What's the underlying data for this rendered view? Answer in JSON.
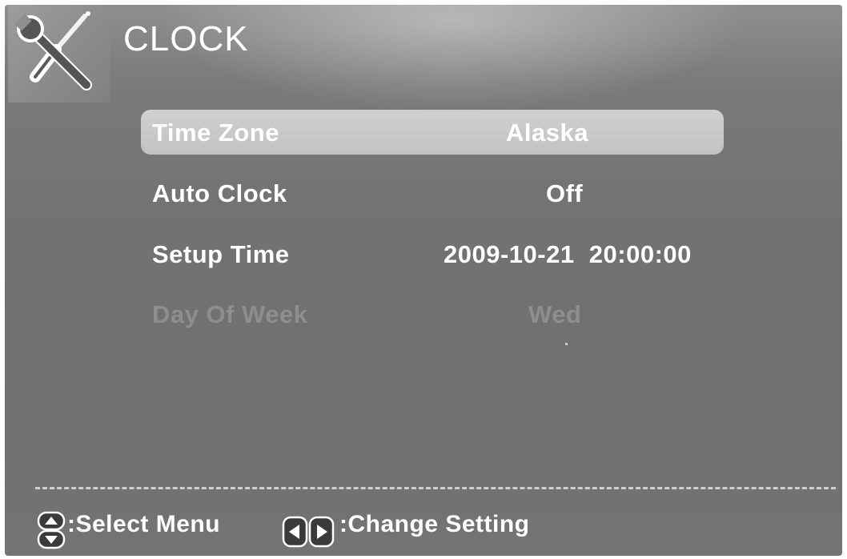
{
  "header": {
    "title": "CLOCK",
    "icon": "tools-icon"
  },
  "menu": {
    "items": [
      {
        "label": "Time Zone",
        "value": "Alaska",
        "state": "selected"
      },
      {
        "label": "Auto Clock",
        "value": "Off",
        "state": "normal"
      },
      {
        "label": "Setup Time",
        "value": "2009-10-21  20:00:00",
        "state": "normal"
      },
      {
        "label": "Day Of Week",
        "value": "Wed",
        "state": "disabled"
      }
    ]
  },
  "footer": {
    "select_icon": "up-down-arrows-icon",
    "select_label": ":Select Menu",
    "change_icon": "left-right-arrows-icon",
    "change_label": ":Change Setting"
  },
  "colors": {
    "background": "#727272",
    "selected_bar": "#c8c8c8",
    "text": "#ffffff",
    "disabled_text": "#8e8e8e"
  }
}
